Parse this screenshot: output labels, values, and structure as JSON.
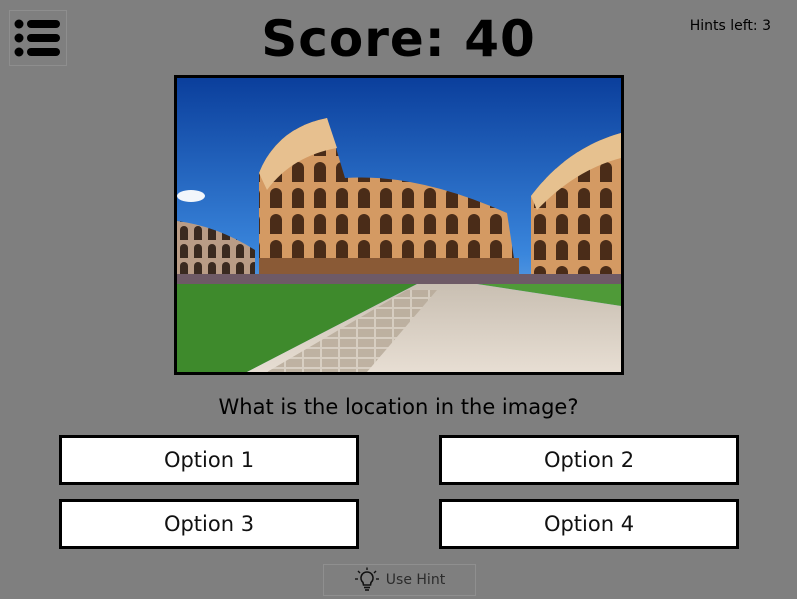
{
  "header": {
    "menu_icon": "list-icon",
    "score_text": "Score: 40",
    "hints_left_text": "Hints left: 3"
  },
  "photo": {
    "subject": "colosseum-photo"
  },
  "quiz": {
    "question": "What is the location in the image?",
    "options": [
      "Option 1",
      "Option 2",
      "Option 3",
      "Option 4"
    ]
  },
  "hint": {
    "icon": "lightbulb-icon",
    "label": "Use Hint"
  },
  "colors": {
    "background": "#7f7f7f",
    "border": "#000000",
    "option_background": "#ffffff"
  }
}
